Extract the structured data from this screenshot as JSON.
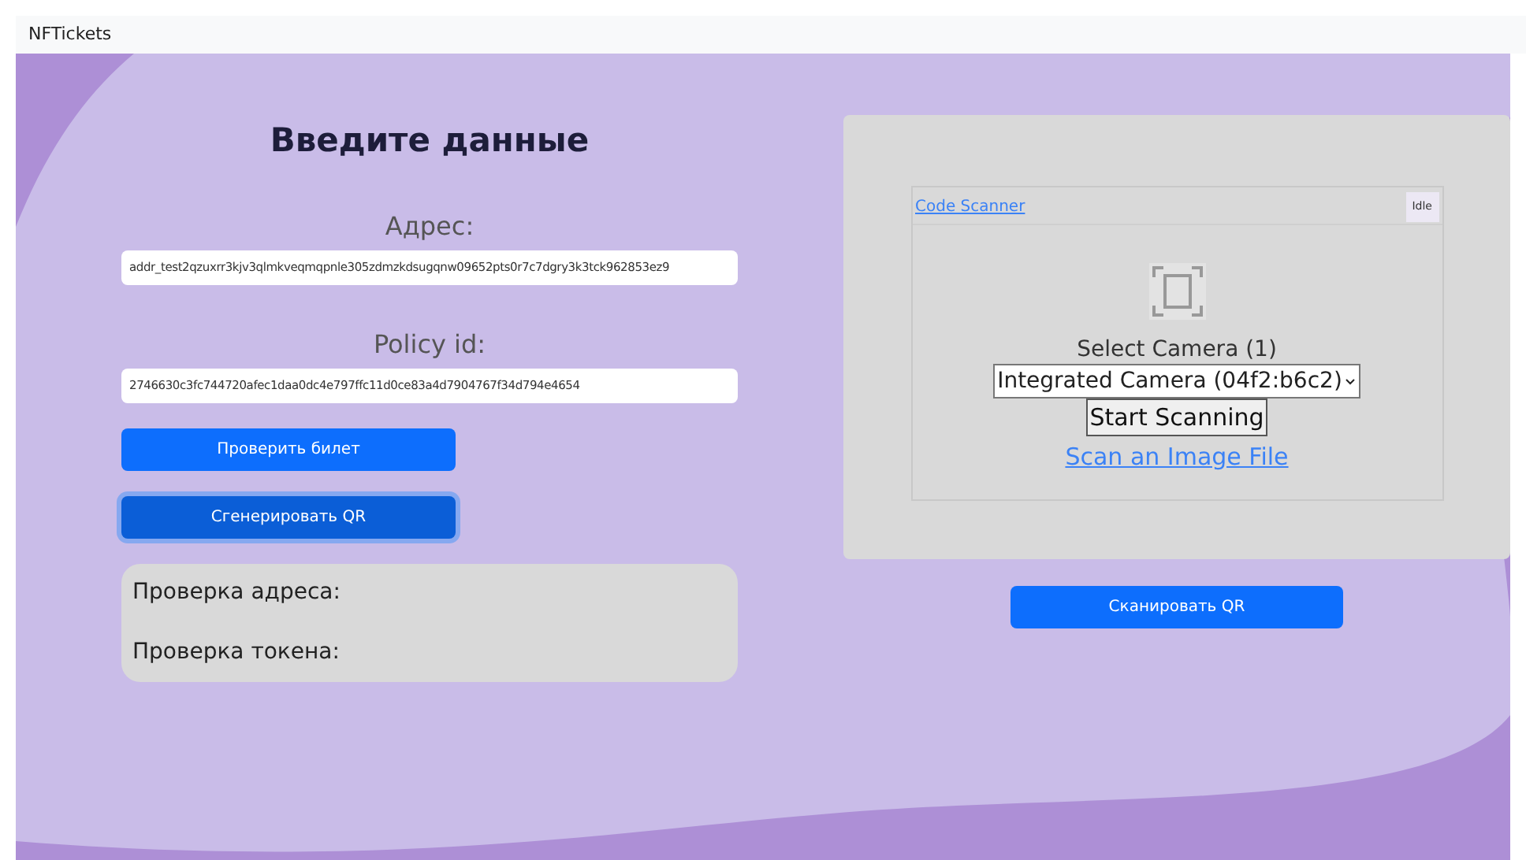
{
  "navbar": {
    "brand": "NFTickets"
  },
  "form": {
    "title": "Введите данные",
    "fields": [
      {
        "label": "Адрес:",
        "value": "addr_test2qzuxrr3kjv3qlmkveqmqpnle305zdmzkdsugqnw09652pts0r7c7dgry3k3tck962853ez9"
      },
      {
        "label": "Policy id:",
        "value": "2746630c3fc744720afec1daa0dc4e797ffc11d0ce83a4d7904767f34d794e4654"
      }
    ],
    "buttons": [
      {
        "label": "Проверить билет",
        "focused": false
      },
      {
        "label": "Сгенерировать QR",
        "focused": true
      }
    ],
    "results": [
      "Проверка адреса:",
      "Проверка токена:"
    ]
  },
  "scanner": {
    "header_link": "Code Scanner",
    "status": "Idle",
    "camera_label": "Select Camera (1)",
    "camera_select": "Integrated Camera (04f2:b6c2)",
    "start_button": "Start Scanning",
    "file_link": "Scan an Image File"
  },
  "scan_button": "Сканировать QR"
}
